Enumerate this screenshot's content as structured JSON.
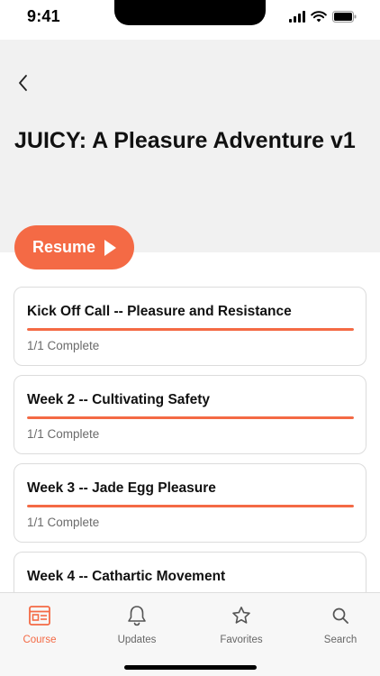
{
  "status_bar": {
    "time": "9:41"
  },
  "header": {
    "back_icon": "chevron-left-icon",
    "title": "JUICY: A Pleasure Adventure v1"
  },
  "resume_button": {
    "label": "Resume",
    "icon": "play-icon"
  },
  "modules": [
    {
      "title": "Kick Off Call -- Pleasure and Resistance",
      "status": "1/1 Complete",
      "progress": 1.0
    },
    {
      "title": "Week 2 -- Cultivating Safety",
      "status": "1/1 Complete",
      "progress": 1.0
    },
    {
      "title": "Week 3 -- Jade Egg Pleasure",
      "status": "1/1 Complete",
      "progress": 1.0
    },
    {
      "title": "Week 4 -- Cathartic Movement",
      "status": "",
      "progress": 1.0
    }
  ],
  "tabs": [
    {
      "label": "Course",
      "icon": "course-icon",
      "active": true
    },
    {
      "label": "Updates",
      "icon": "bell-icon",
      "active": false
    },
    {
      "label": "Favorites",
      "icon": "star-icon",
      "active": false
    },
    {
      "label": "Search",
      "icon": "search-icon",
      "active": false
    }
  ],
  "colors": {
    "accent": "#f46a45",
    "header_bg": "#f1f1f1",
    "tab_bar_bg": "#f7f7f7",
    "muted_text": "#6b6b6b"
  }
}
